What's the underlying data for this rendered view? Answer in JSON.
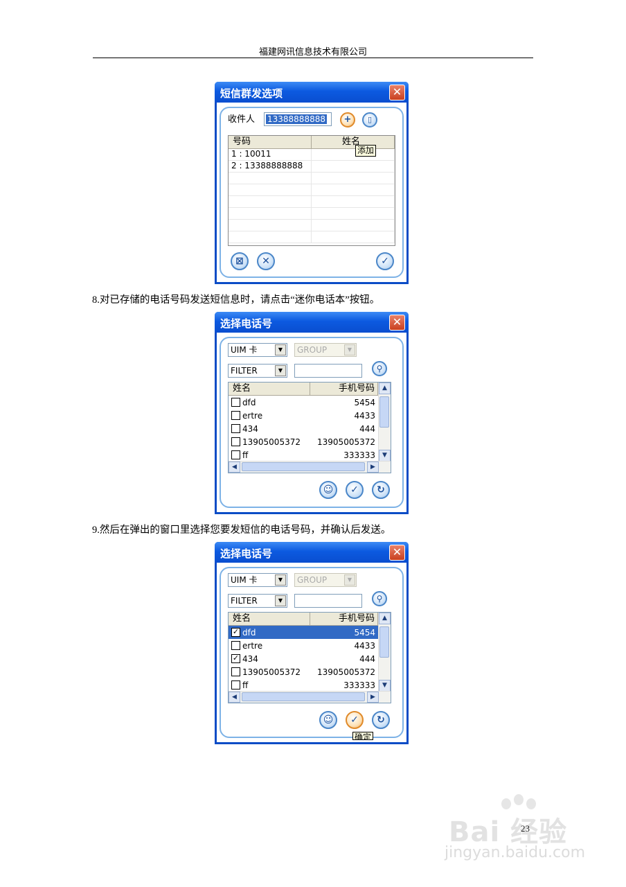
{
  "header": {
    "company": "福建网讯信息技术有限公司"
  },
  "paragraphs": {
    "step8": "8.对已存储的电话号码发送短信息时，请点击“迷你电话本”按钮。",
    "step9": "9.然后在弹出的窗口里选择您要发短信的电话号码，并确认后发送。"
  },
  "dialog1": {
    "title": "短信群发选项",
    "recipient_label": "收件人",
    "recipient_value": "13388888888",
    "tooltip": "添加",
    "columns": [
      "号码",
      "姓名"
    ],
    "rows": [
      {
        "number": "1 : 10011",
        "name": ""
      },
      {
        "number": "2 : 13388888888",
        "name": ""
      }
    ]
  },
  "dialog2": {
    "title": "选择电话号",
    "source": "UIM 卡",
    "group": "GROUP",
    "filter": "FILTER",
    "search_value": "",
    "columns": [
      "姓名",
      "手机号码"
    ],
    "rows": [
      {
        "name": "dfd",
        "phone": "5454",
        "checked": false
      },
      {
        "name": "ertre",
        "phone": "4433",
        "checked": false
      },
      {
        "name": "434",
        "phone": "444",
        "checked": false
      },
      {
        "name": "13905005372",
        "phone": "13905005372",
        "checked": false
      },
      {
        "name": "ff",
        "phone": "333333",
        "checked": false
      }
    ]
  },
  "dialog3": {
    "title": "选择电话号",
    "source": "UIM 卡",
    "group": "GROUP",
    "filter": "FILTER",
    "search_value": "",
    "columns": [
      "姓名",
      "手机号码"
    ],
    "tooltip": "确定",
    "rows": [
      {
        "name": "dfd",
        "phone": "5454",
        "checked": true,
        "selected": true
      },
      {
        "name": "ertre",
        "phone": "4433",
        "checked": false
      },
      {
        "name": "434",
        "phone": "444",
        "checked": true
      },
      {
        "name": "13905005372",
        "phone": "13905005372",
        "checked": false
      },
      {
        "name": "ff",
        "phone": "333333",
        "checked": false
      }
    ]
  },
  "page_number": "23",
  "watermark": {
    "logo": "Bai 经验",
    "url": "jingyan.baidu.com"
  }
}
